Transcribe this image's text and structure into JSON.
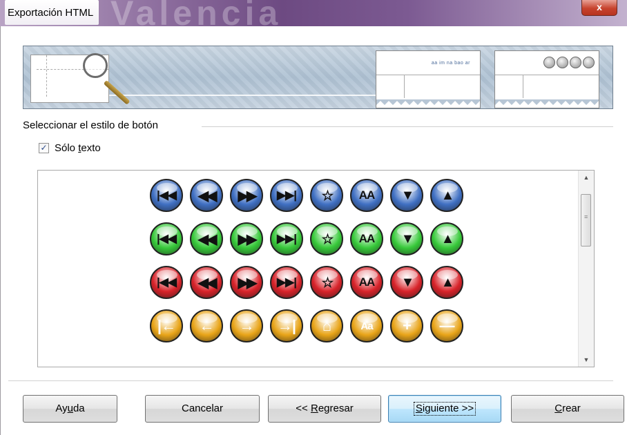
{
  "window": {
    "title": "Exportación HTML",
    "background_word": "Valencia",
    "close_label": "x"
  },
  "banner": {
    "thumb_menu_text": "aa im na bao ar"
  },
  "group": {
    "label": "Seleccionar el estilo de botón",
    "checkbox_label_pre": "Sólo ",
    "checkbox_label_u": "t",
    "checkbox_label_post": "exto",
    "checkbox_checked": true,
    "checkbox_mark": "✓"
  },
  "button_styles": [
    {
      "name": "blue",
      "color": "#3f6fc2",
      "glyphs": [
        "|◀◀",
        "◀◀",
        "▶▶",
        "▶▶|",
        "☆",
        "AA",
        "▼",
        "▲"
      ]
    },
    {
      "name": "green",
      "color": "#37c93a",
      "glyphs": [
        "|◀◀",
        "◀◀",
        "▶▶",
        "▶▶|",
        "☆",
        "AA",
        "▼",
        "▲"
      ]
    },
    {
      "name": "red",
      "color": "#d8232a",
      "glyphs": [
        "|◀◀",
        "◀◀",
        "▶▶",
        "▶▶|",
        "☆",
        "AA",
        "▼",
        "▲"
      ]
    },
    {
      "name": "orange",
      "color": "#e8a418",
      "glyphs": [
        "|←",
        "←",
        "→",
        "→|",
        "⌂",
        "Aa",
        "+",
        "—"
      ]
    }
  ],
  "scrollbar": {
    "up": "▲",
    "down": "▼",
    "grip": "≡"
  },
  "buttons": {
    "help_pre": "Ay",
    "help_u": "u",
    "help_post": "da",
    "cancel": "Cancelar",
    "back_pre": "<< ",
    "back_u": "R",
    "back_post": "egresar",
    "next_u": "S",
    "next_post": "iguiente >>",
    "create_u": "C",
    "create_post": "rear"
  }
}
